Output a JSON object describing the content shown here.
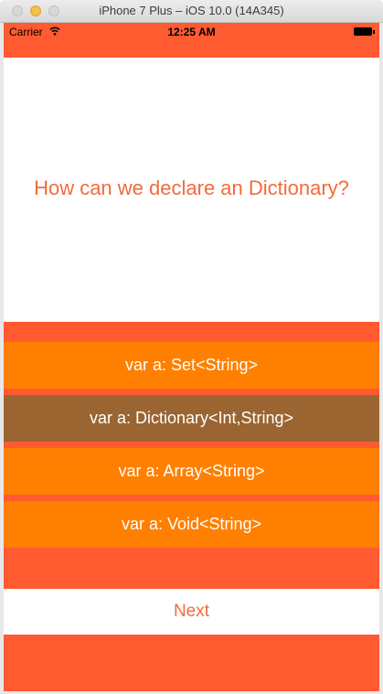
{
  "window": {
    "title": "iPhone 7 Plus – iOS 10.0 (14A345)"
  },
  "status_bar": {
    "carrier": "Carrier",
    "time": "12:25 AM",
    "icons": [
      "wifi-icon",
      "battery-icon"
    ]
  },
  "question": {
    "text": "How can we declare an Dictionary?"
  },
  "answers": [
    {
      "label": "var a: Set<String>",
      "selected": false
    },
    {
      "label": "var a: Dictionary<Int,String>",
      "selected": true
    },
    {
      "label": "var a: Array<String>",
      "selected": false
    },
    {
      "label": "var a: Void<String>",
      "selected": false
    }
  ],
  "next_button": {
    "label": "Next"
  },
  "colors": {
    "background": "#ff5a30",
    "answer": "#ff7f00",
    "answer_selected": "#9a6531",
    "question_text": "#f26b3a"
  }
}
